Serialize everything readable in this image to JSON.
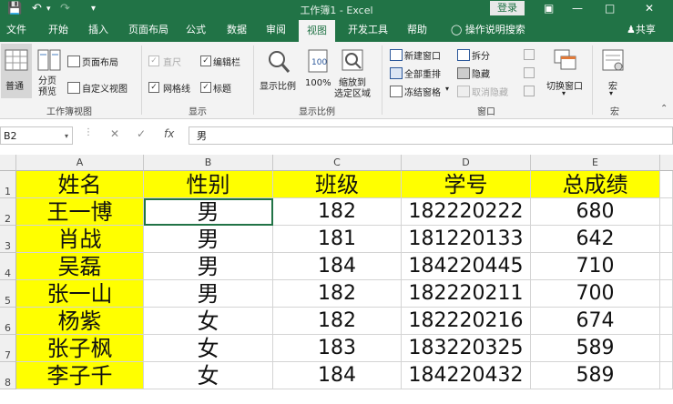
{
  "titlebar": {
    "title": "工作簿1 - Excel",
    "login": "登录",
    "colors": {
      "brand": "#217346"
    }
  },
  "tabs": [
    {
      "label": "文件"
    },
    {
      "label": "开始"
    },
    {
      "label": "插入"
    },
    {
      "label": "页面布局"
    },
    {
      "label": "公式"
    },
    {
      "label": "数据"
    },
    {
      "label": "审阅"
    },
    {
      "label": "视图",
      "active": true
    },
    {
      "label": "开发工具"
    },
    {
      "label": "帮助"
    }
  ],
  "tell_me": "操作说明搜索",
  "share": "共享",
  "ribbon": {
    "workbook_views": {
      "label": "工作簿视图",
      "normal": "普通",
      "page_break": "分页\n预览",
      "page_layout": "页面布局",
      "custom_views": "自定义视图"
    },
    "show": {
      "label": "显示",
      "ruler": "直尺",
      "formula_bar": "编辑栏",
      "gridlines": "网格线",
      "headings": "标题"
    },
    "zoom": {
      "label": "显示比例",
      "zoom": "显示比例",
      "hundred": "100%",
      "zoom_selection_1": "缩放到",
      "zoom_selection_2": "选定区域"
    },
    "window": {
      "label": "窗口",
      "new_window": "新建窗口",
      "arrange_all": "全部重排",
      "freeze_panes": "冻结窗格",
      "split": "拆分",
      "hide": "隐藏",
      "unhide": "取消隐藏",
      "switch_windows": "切换窗口"
    },
    "macros": {
      "label": "宏",
      "macros": "宏"
    }
  },
  "formula_bar": {
    "name_box": "B2",
    "cancel": "✕",
    "enter": "✓",
    "fx": "fx",
    "content": "男"
  },
  "sheet": {
    "columns": [
      "A",
      "B",
      "C",
      "D",
      "E"
    ],
    "row_numbers": [
      "1",
      "2",
      "3",
      "4",
      "5",
      "6",
      "7",
      "8"
    ],
    "header": [
      "姓名",
      "性别",
      "班级",
      "学号",
      "总成绩"
    ],
    "rows": [
      [
        "王一博",
        "男",
        "182",
        "182220222",
        "680"
      ],
      [
        "肖战",
        "男",
        "181",
        "181220133",
        "642"
      ],
      [
        "吴磊",
        "男",
        "184",
        "184220445",
        "710"
      ],
      [
        "张一山",
        "男",
        "182",
        "182220211",
        "700"
      ],
      [
        "杨紫",
        "女",
        "182",
        "182220216",
        "674"
      ],
      [
        "张子枫",
        "女",
        "183",
        "183220325",
        "589"
      ],
      [
        "李子千",
        "女",
        "184",
        "184220432",
        "589"
      ]
    ],
    "highlight_color": "#ffff00"
  }
}
